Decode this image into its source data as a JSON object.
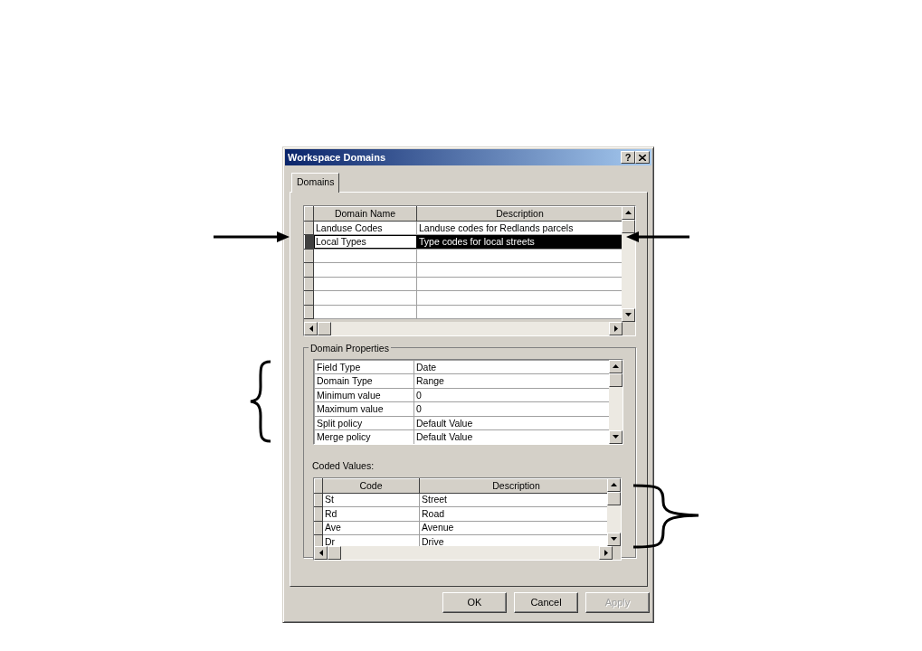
{
  "window": {
    "title": "Workspace Domains",
    "help": "?"
  },
  "tabs": [
    {
      "label": "Domains",
      "selected": true
    }
  ],
  "domains": {
    "columns": [
      "Domain Name",
      "Description"
    ],
    "rows": [
      {
        "cells": [
          "Landuse Codes",
          "Landuse codes for Redlands parcels"
        ],
        "selected": false
      },
      {
        "cells": [
          "Local Types",
          "Type codes for local streets"
        ],
        "selected": true
      }
    ]
  },
  "domain_properties": {
    "title": "Domain Properties",
    "rows": [
      [
        "Field Type",
        "Date"
      ],
      [
        "Domain Type",
        "Range"
      ],
      [
        "Minimum value",
        "0"
      ],
      [
        "Maximum value",
        "0"
      ],
      [
        "Split policy",
        "Default Value"
      ],
      [
        "Merge policy",
        "Default Value"
      ]
    ]
  },
  "coded_values": {
    "label": "Coded Values:",
    "columns": [
      "Code",
      "Description"
    ],
    "rows": [
      [
        "St",
        "Street"
      ],
      [
        "Rd",
        "Road"
      ],
      [
        "Ave",
        "Avenue"
      ],
      [
        "Dr",
        "Drive"
      ]
    ]
  },
  "buttons": [
    {
      "label": "OK",
      "disabled": false
    },
    {
      "label": "Cancel",
      "disabled": false
    },
    {
      "label": "Apply",
      "disabled": true
    }
  ]
}
